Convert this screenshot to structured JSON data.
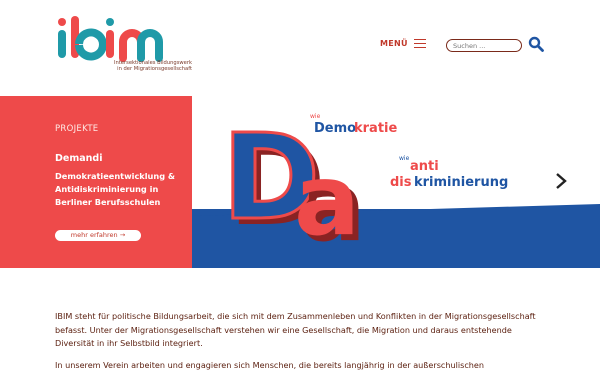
{
  "header": {
    "logo_text": "ibim",
    "logo_subtitle_line1": "Intersektionales Bildungswerk",
    "logo_subtitle_line2": "in der Migrationsgesellschaft",
    "menu_label": "MENÜ",
    "search_placeholder": "Suchen ..."
  },
  "hero": {
    "section_label": "PROJEKTE",
    "title": "Demаndi",
    "description": "Demokratieentwicklung & Antidiskriminierung in Berliner Berufsschulen",
    "more_label": "mehr erfahren →",
    "art": {
      "letter_d": "D",
      "letter_a": "a",
      "wie1": "wie",
      "demo_prefix": "Demo",
      "demo_suffix": "kratie",
      "wie2": "wie",
      "anti": "anti",
      "dis": "dis",
      "krim": "kriminierung"
    }
  },
  "content": {
    "paragraph1": "IBIM steht für politische Bildungsarbeit, die sich mit dem Zusammenleben und Konflikten in der Migrationsgesellschaft befasst. Unter der Migrationsgesellschaft verstehen wir eine Gesellschaft, die Migration und daraus entstehende Diversität in ihr Selbstbild integriert.",
    "paragraph2": "In unserem Verein arbeiten und engagieren sich Menschen, die bereits langjährig in der außerschulischen"
  },
  "colors": {
    "red": "#ee4a4a",
    "blue": "#1f55a3",
    "teal": "#1f9aa8",
    "dark_red_text": "#5a1e0e"
  }
}
